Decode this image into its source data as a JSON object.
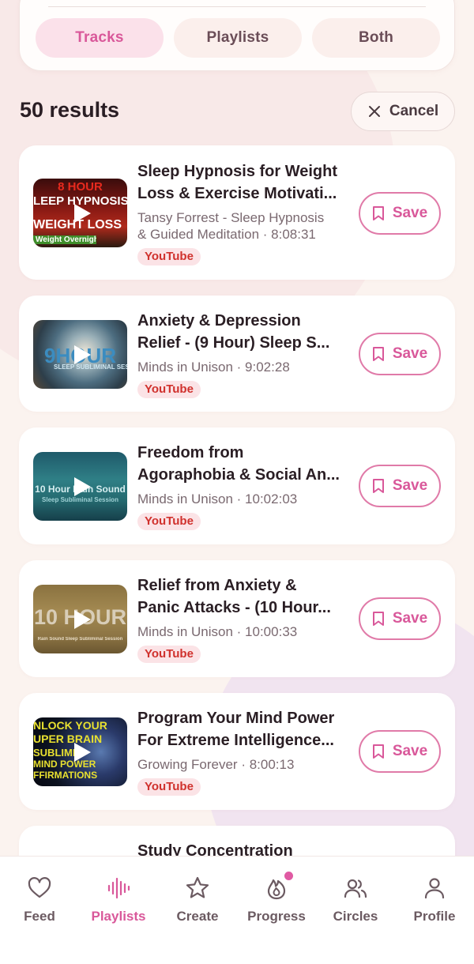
{
  "filters": {
    "segments": [
      "Tracks",
      "Playlists",
      "Both"
    ],
    "active": "Tracks"
  },
  "results": {
    "count_label": "50 results",
    "cancel_label": "Cancel"
  },
  "tracks": [
    {
      "title_line1": "Sleep Hypnosis for Weight",
      "title_line2": "Loss & Exercise Motivati...",
      "subtitle_line1": "Tansy Forrest - Sleep Hypnosis",
      "subtitle_line2": "& Guided Meditation · 8:08:31",
      "source": "YouTube",
      "save_label": "Save",
      "thumb_text_a": "8 HOUR",
      "thumb_text_b": "LEEP HYPNOSIS",
      "thumb_text_c": "WEIGHT LOSS",
      "thumb_text_d": "Weight Overnight!"
    },
    {
      "title_line1": "Anxiety & Depression",
      "title_line2": "Relief - (9 Hour) Sleep S...",
      "subtitle_line1": "Minds in Unison · 9:02:28",
      "subtitle_line2": "",
      "source": "YouTube",
      "save_label": "Save",
      "thumb_text_a": "9HOUR",
      "thumb_text_b": "SLEEP SUBLIMINAL SESSION"
    },
    {
      "title_line1": "Freedom from",
      "title_line2": "Agoraphobia & Social An...",
      "subtitle_line1": "Minds in Unison · 10:02:03",
      "subtitle_line2": "",
      "source": "YouTube",
      "save_label": "Save",
      "thumb_text_a": "10 Hour Rain Sound",
      "thumb_text_b": "Sleep Subliminal Session"
    },
    {
      "title_line1": "Relief from Anxiety &",
      "title_line2": "Panic Attacks - (10 Hour...",
      "subtitle_line1": "Minds in Unison · 10:00:33",
      "subtitle_line2": "",
      "source": "YouTube",
      "save_label": "Save",
      "thumb_text_a": "10 HOUR",
      "thumb_text_b": "Rain Sound Sleep Subliminal Session"
    },
    {
      "title_line1": "Program Your Mind Power",
      "title_line2": "For Extreme Intelligence...",
      "subtitle_line1": "Growing Forever · 8:00:13",
      "subtitle_line2": "",
      "source": "YouTube",
      "save_label": "Save",
      "thumb_text_a": "NLOCK YOUR",
      "thumb_text_b": "UPER BRAIN",
      "thumb_text_c": "SUBLIMIN",
      "thumb_text_d": "MIND POWER",
      "thumb_text_e": "FFIRMATIONS"
    },
    {
      "title_line1": "Study Concentration"
    }
  ],
  "nav": {
    "items": [
      "Feed",
      "Playlists",
      "Create",
      "Progress",
      "Circles",
      "Profile"
    ],
    "active": "Playlists",
    "notification_dot_on": "Progress"
  },
  "colors": {
    "accent": "#d9589a",
    "youtube_red": "#d0312d",
    "background": "#fbf3ef"
  }
}
